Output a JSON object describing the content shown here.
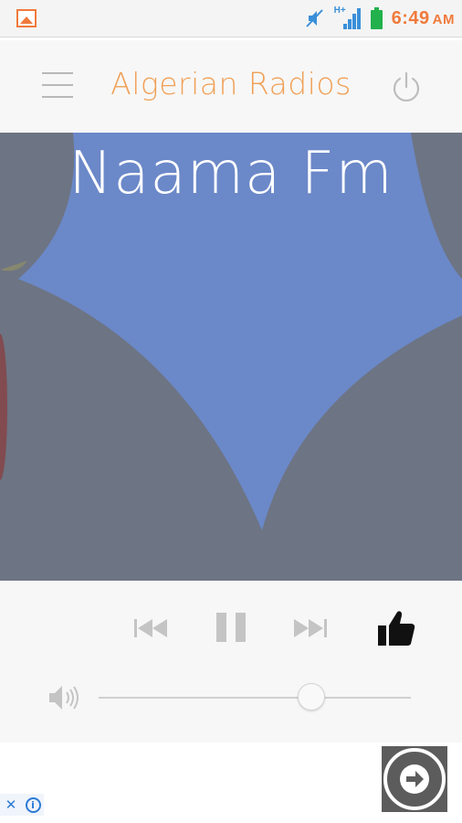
{
  "status_bar": {
    "time": "6:49",
    "ampm": "AM",
    "network_label": "H+",
    "icons": [
      "gallery-icon",
      "mute-icon",
      "signal-icon",
      "battery-icon"
    ]
  },
  "app_bar": {
    "title": "Algerian Radios",
    "menu_icon": "hamburger-menu-icon",
    "power_icon": "power-icon"
  },
  "player": {
    "station_name": "Naama Fm",
    "controls": [
      "previous-icon",
      "pause-icon",
      "next-icon",
      "thumbs-up-icon"
    ],
    "volume_level": 0.68
  },
  "ad": {
    "close_symbol": "✕",
    "info_symbol": "i",
    "action_icon": "arrow-right-icon"
  },
  "colors": {
    "accent": "#f0a057",
    "status_accent": "#f07a3c",
    "artwork_bg": "#6d7483",
    "artwork_shape": "#6b88c8"
  }
}
